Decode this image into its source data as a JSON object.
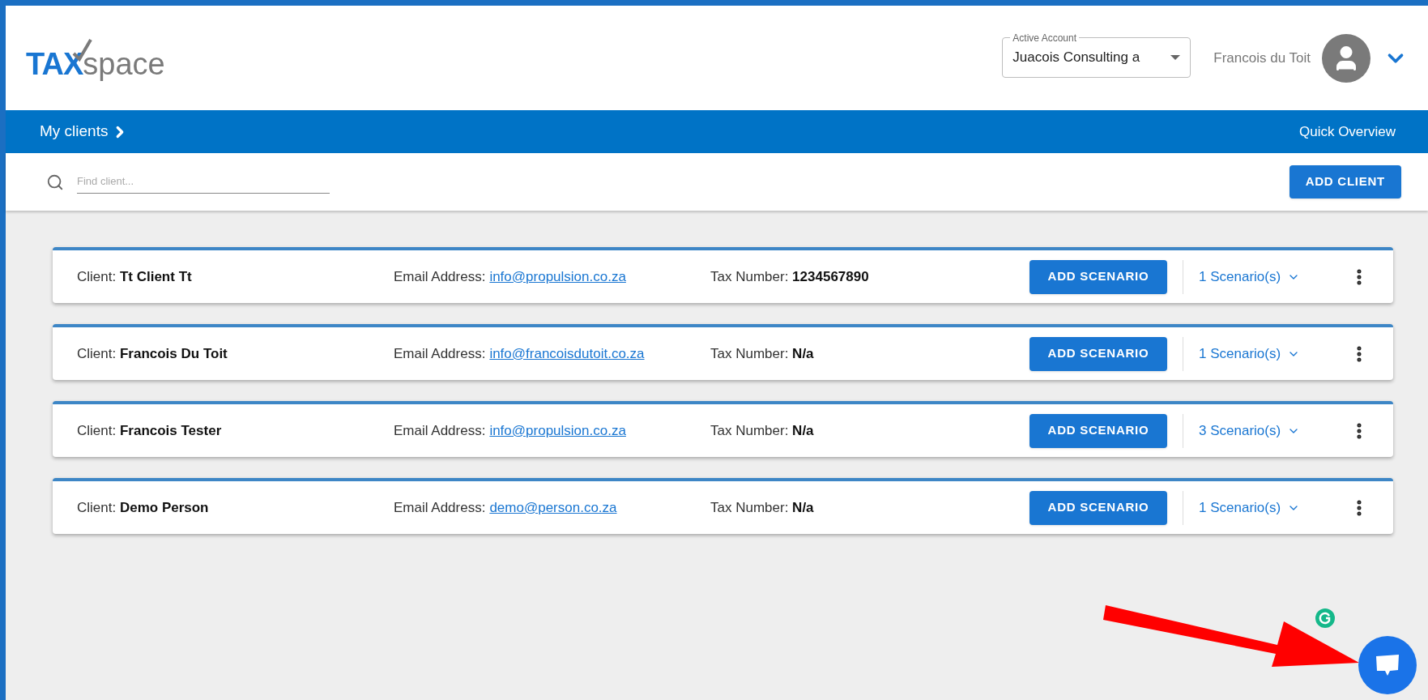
{
  "logo": {
    "prefix": "TAX",
    "suffix": "space"
  },
  "account": {
    "label": "Active Account",
    "value": "Juacois Consulting a"
  },
  "user": {
    "name": "Francois du Toit"
  },
  "nav": {
    "breadcrumb": "My clients",
    "quick_link": "Quick Overview"
  },
  "search": {
    "placeholder": "Find client..."
  },
  "add_client": "ADD CLIENT",
  "clients": [
    {
      "client_label": "Client:",
      "name": "Tt Client Tt",
      "email_label": "Email Address:",
      "email": "info@propulsion.co.za",
      "tax_label": "Tax Number:",
      "tax_number": "1234567890",
      "action": "ADD SCENARIO",
      "scenarios": "1 Scenario(s)"
    },
    {
      "client_label": "Client:",
      "name": "Francois Du Toit",
      "email_label": "Email Address:",
      "email": "info@francoisdutoit.co.za",
      "tax_label": "Tax Number:",
      "tax_number": "N/a",
      "action": "ADD SCENARIO",
      "scenarios": "1 Scenario(s)"
    },
    {
      "client_label": "Client:",
      "name": "Francois Tester",
      "email_label": "Email Address:",
      "email": "info@propulsion.co.za",
      "tax_label": "Tax Number:",
      "tax_number": "N/a",
      "action": "ADD SCENARIO",
      "scenarios": "3 Scenario(s)"
    },
    {
      "client_label": "Client:",
      "name": "Demo Person",
      "email_label": "Email Address:",
      "email": "demo@person.co.za",
      "tax_label": "Tax Number:",
      "tax_number": "N/a",
      "action": "ADD SCENARIO",
      "scenarios": "1 Scenario(s)"
    }
  ]
}
